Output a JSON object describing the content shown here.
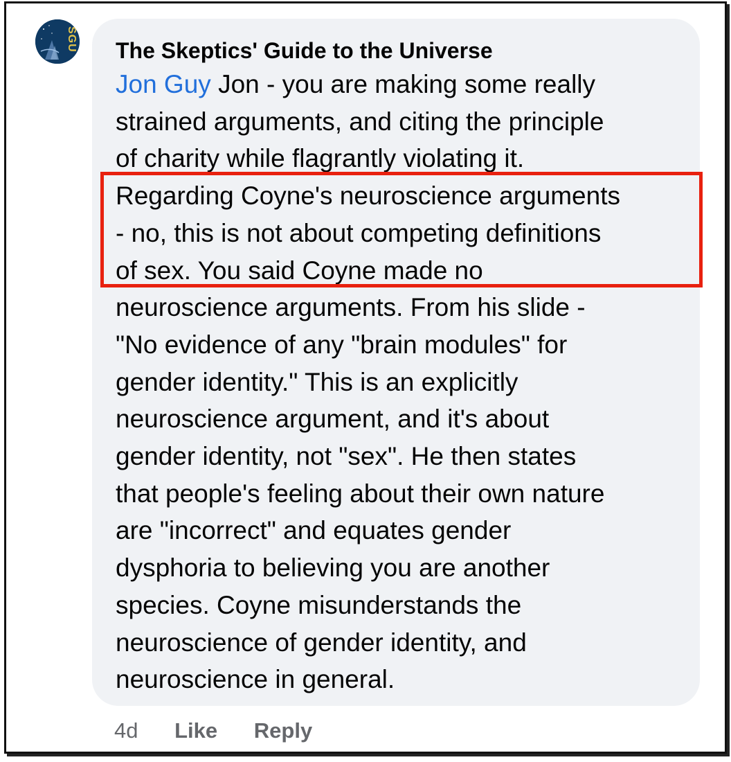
{
  "comment": {
    "avatar": {
      "icon": "skeptics-guide-logo-icon",
      "logo_text": "SGU",
      "background_color": "#0f3a63",
      "accent_color": "#e2c34a"
    },
    "author": "The Skeptics' Guide to the Universe",
    "mention": "Jon Guy",
    "lines": [
      " Jon - you are making some really",
      "strained arguments, and citing the principle",
      "of charity while flagrantly violating it.",
      "Regarding Coyne's neuroscience arguments",
      "- no, this is not about competing definitions",
      "of sex. You said Coyne made no",
      "neuroscience arguments. From his slide -",
      "\"No evidence of any \"brain modules\" for",
      "gender identity.\" This is an explicitly",
      "neuroscience argument, and it's about",
      "gender identity, not \"sex\".  He then states",
      "that people's feeling about their own nature",
      "are \"incorrect\" and equates gender",
      "dysphoria to believing you are another",
      "species. Coyne misunderstands the",
      "neuroscience of gender identity, and",
      "neuroscience in general."
    ],
    "highlight_color": "#e8210f",
    "mention_color": "#216fdb"
  },
  "actions": {
    "timestamp": "4d",
    "like_label": "Like",
    "reply_label": "Reply"
  }
}
